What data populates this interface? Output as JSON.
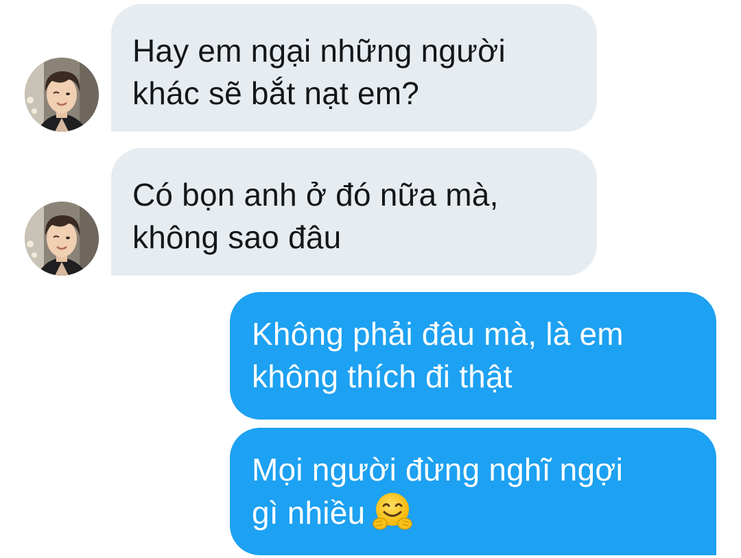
{
  "conversation": {
    "messages": [
      {
        "direction": "incoming",
        "lines": [
          "Hay em ngại những người",
          "khác sẽ bắt nạt em?"
        ]
      },
      {
        "direction": "incoming",
        "lines": [
          "Có bọn anh ở đó nữa mà,",
          "không sao đâu"
        ]
      },
      {
        "direction": "outgoing",
        "lines": [
          "Không phải đâu mà, là em",
          "không thích đi thật"
        ]
      },
      {
        "direction": "outgoing",
        "lines": [
          "Mọi người đừng nghĩ ngợi",
          "gì nhiều"
        ],
        "emoji": "hugging-face-emoji"
      }
    ]
  },
  "colors": {
    "incoming_bubble": "#e6ecf0",
    "outgoing_bubble": "#1da1f2",
    "incoming_text": "#14171a",
    "outgoing_text": "#ffffff"
  },
  "icons": {
    "avatar": "user-avatar-photo",
    "emoji": "hugging-face-emoji"
  }
}
